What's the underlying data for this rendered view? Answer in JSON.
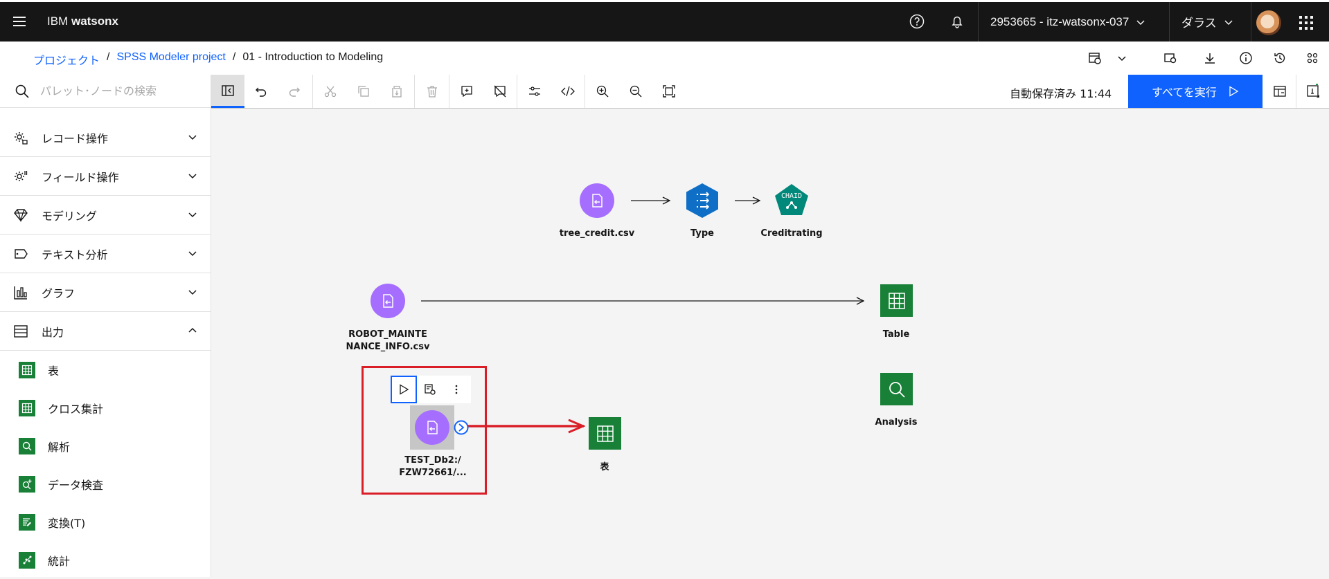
{
  "header": {
    "brand_ibm": "IBM",
    "brand_product": "watsonx",
    "account": "2953665 - itz-watsonx-037",
    "region": "ダラス"
  },
  "breadcrumb": {
    "items": [
      "プロジェクト",
      "SPSS Modeler project"
    ],
    "current": "01 - Introduction to Modeling"
  },
  "sidebar": {
    "search_placeholder": "パレット･ノードの検索",
    "categories": [
      {
        "label": "レコード操作",
        "icon": "record-ops-icon"
      },
      {
        "label": "フィールド操作",
        "icon": "field-ops-icon"
      },
      {
        "label": "モデリング",
        "icon": "modeling-icon"
      },
      {
        "label": "テキスト分析",
        "icon": "text-analytics-icon"
      },
      {
        "label": "グラフ",
        "icon": "graph-icon"
      },
      {
        "label": "出力",
        "icon": "output-icon"
      }
    ],
    "output_items": [
      {
        "label": "表",
        "icon": "table-icon"
      },
      {
        "label": "クロス集計",
        "icon": "matrix-icon"
      },
      {
        "label": "解析",
        "icon": "analysis-icon"
      },
      {
        "label": "データ検査",
        "icon": "data-audit-icon"
      },
      {
        "label": "変換(T)",
        "icon": "transform-icon"
      },
      {
        "label": "統計",
        "icon": "statistics-icon"
      }
    ]
  },
  "toolbar": {
    "autosave": "自動保存済み 11:44",
    "run_all": "すべてを実行"
  },
  "canvas": {
    "nodes": {
      "tree_credit": "tree_credit.csv",
      "type": "Type",
      "chaid_badge": "CHAID",
      "creditrating": "Creditrating",
      "robot_line1": "ROBOT_MAINTE",
      "robot_line2": "NANCE_INFO.csv",
      "table": "Table",
      "analysis": "Analysis",
      "test_line1": "TEST_Db2:/",
      "test_line2": "FZW72661/...",
      "hyo": "表"
    }
  },
  "colors": {
    "accent": "#0f62fe",
    "import_node": "#a56eff",
    "output_node": "#198038",
    "type_node": "#0f6fc6",
    "model_node": "#00887a",
    "annotation": "#da1e28"
  }
}
